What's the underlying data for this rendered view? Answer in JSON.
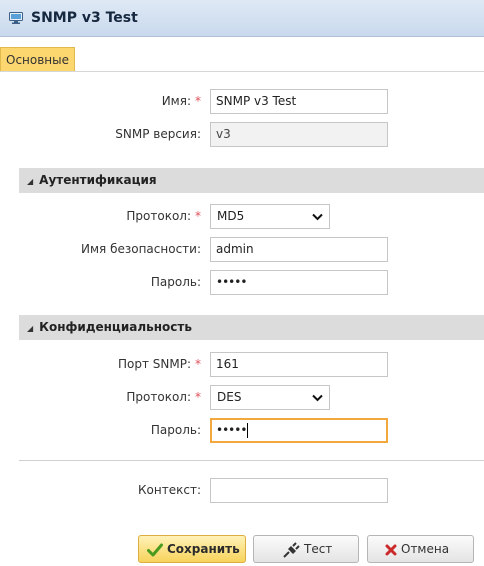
{
  "window": {
    "title": "SNMP v3 Test"
  },
  "tabs": [
    {
      "label": "Основные",
      "active": true
    }
  ],
  "general": {
    "name_label": "Имя:",
    "name_value": "SNMP v3 Test",
    "version_label": "SNMP версия:",
    "version_value": "v3"
  },
  "auth": {
    "section_title": "Аутентификация",
    "protocol_label": "Протокол:",
    "protocol_value": "MD5",
    "security_name_label": "Имя безопасности:",
    "security_name_value": "admin",
    "password_label": "Пароль:",
    "password_value": "•••••"
  },
  "privacy": {
    "section_title": "Конфиденциальность",
    "port_label": "Порт SNMP:",
    "port_value": "161",
    "protocol_label": "Протокол:",
    "protocol_value": "DES",
    "password_label": "Пароль:",
    "password_value": "•••••"
  },
  "context": {
    "label": "Контекст:",
    "value": ""
  },
  "required_marker": "*",
  "buttons": {
    "save": "Сохранить",
    "test": "Тест",
    "cancel": "Отмена"
  },
  "colors": {
    "accent": "#fcd66f",
    "focus_border": "#f2a83d",
    "required": "#e0505a",
    "save_check": "#4a9a1f",
    "cancel_x": "#cc2a2a",
    "section_bg": "#dcdcdc",
    "titlebar": "#c9d9ed"
  },
  "icons": {
    "title": "monitor-network-icon",
    "save": "checkmark-icon",
    "test": "plug-icon",
    "cancel": "x-icon",
    "section_toggle": "triangle-collapse-icon",
    "dropdown": "chevron-down-icon"
  }
}
